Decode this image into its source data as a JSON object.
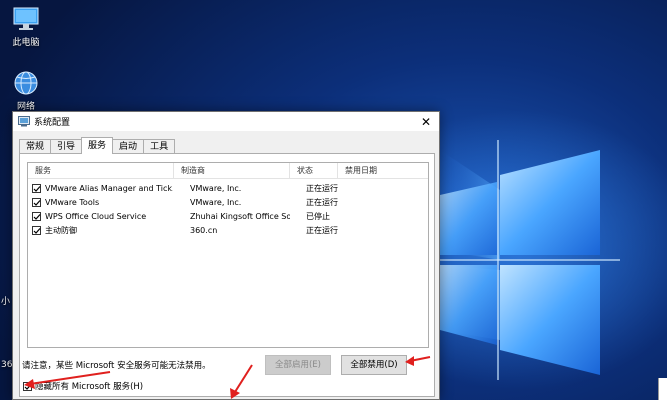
{
  "desktop": {
    "icons": [
      {
        "label": "此电脑",
        "icon": "computer-icon"
      },
      {
        "label": "网络",
        "icon": "network-globe-icon"
      }
    ],
    "side_fragments": [
      "小",
      "36"
    ]
  },
  "dialog": {
    "title": "系统配置",
    "app_icon": "msconfig-icon",
    "close_glyph": "✕",
    "tabs": [
      {
        "label": "常规",
        "active": false
      },
      {
        "label": "引导",
        "active": false
      },
      {
        "label": "服务",
        "active": true
      },
      {
        "label": "启动",
        "active": false
      },
      {
        "label": "工具",
        "active": false
      }
    ],
    "services": {
      "columns": [
        "服务",
        "制造商",
        "状态",
        "禁用日期"
      ],
      "rows": [
        {
          "name": "VMware Alias Manager and Tick...",
          "vendor": "VMware, Inc.",
          "status": "正在运行",
          "disabled_date": "",
          "checked": true
        },
        {
          "name": "VMware Tools",
          "vendor": "VMware, Inc.",
          "status": "正在运行",
          "disabled_date": "",
          "checked": true
        },
        {
          "name": "WPS Office Cloud Service",
          "vendor": "Zhuhai Kingsoft Office Soft...",
          "status": "已停止",
          "disabled_date": "",
          "checked": true
        },
        {
          "name": "主动防御",
          "vendor": "360.cn",
          "status": "正在运行",
          "disabled_date": "",
          "checked": true
        }
      ]
    },
    "notice": "请注意，某些 Microsoft 安全服务可能无法禁用。",
    "enable_all_label": "全部启用(E)",
    "disable_all_label": "全部禁用(D)",
    "hide_ms_label": "隐藏所有 Microsoft 服务(H)",
    "hide_ms_checked": true
  },
  "annotation_color": "#e0201e"
}
